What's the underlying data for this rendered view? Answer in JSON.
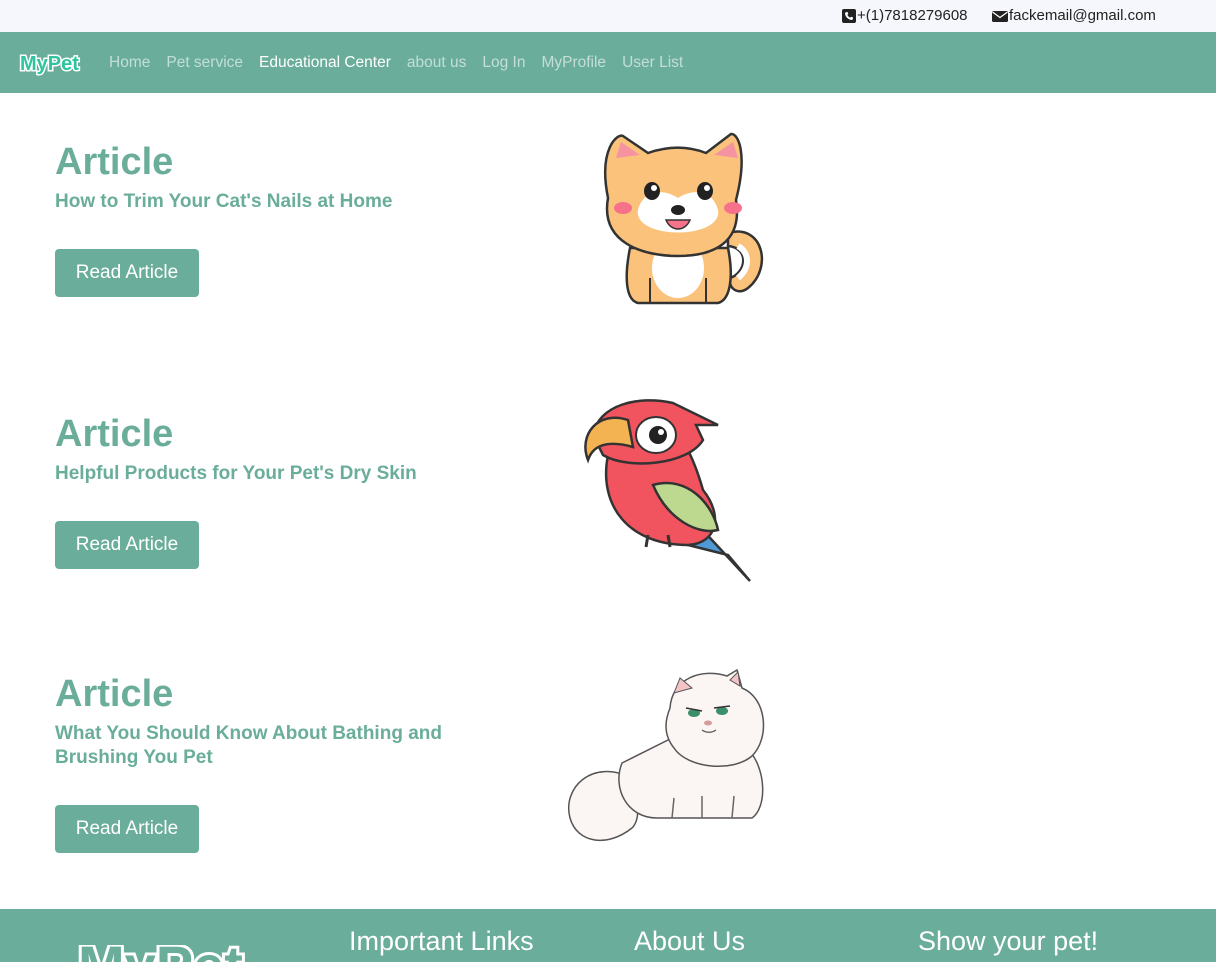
{
  "contact": {
    "phone": "+(1)7818279608",
    "email": "fackemail@gmail.com"
  },
  "brand": {
    "logo_text": "MyPet"
  },
  "nav": {
    "items": [
      {
        "label": "Home",
        "active": false
      },
      {
        "label": "Pet service",
        "active": false
      },
      {
        "label": "Educational Center",
        "active": true
      },
      {
        "label": "about us",
        "active": false
      },
      {
        "label": "Log In",
        "active": false
      },
      {
        "label": "MyProfile",
        "active": false
      },
      {
        "label": "User List",
        "active": false
      }
    ]
  },
  "articles": [
    {
      "heading": "Article",
      "title": "How to Trim Your Cat's Nails at Home",
      "button": "Read Article",
      "image": "shiba-dog-illustration"
    },
    {
      "heading": "Article",
      "title": "Helpful Products for Your Pet's Dry Skin",
      "button": "Read Article",
      "image": "parrot-illustration"
    },
    {
      "heading": "Article",
      "title": "What You Should Know About Bathing and Brushing You Pet",
      "button": "Read Article",
      "image": "persian-cat-illustration"
    }
  ],
  "footer": {
    "logo_text": "MyPet",
    "important_links": "Important Links",
    "about_us": "About Us",
    "show_pet": "Show your pet!"
  },
  "colors": {
    "accent": "#6aad9a",
    "topbar": "#f6f7fc",
    "nav_inactive": "rgba(255,255,255,0.6)",
    "nav_active": "#ffffff"
  },
  "icons": [
    "phone-square-icon",
    "envelope-icon"
  ]
}
